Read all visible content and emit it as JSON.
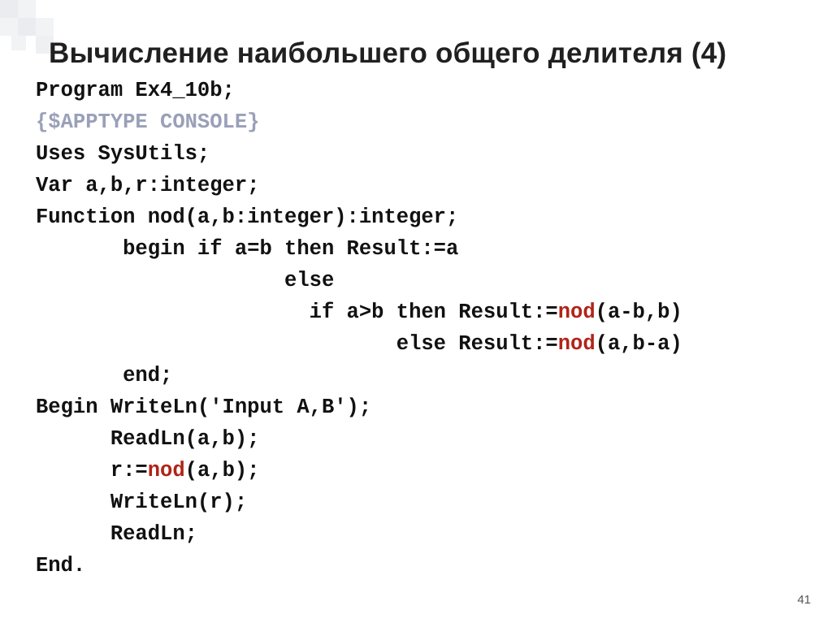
{
  "title": "Вычисление наибольшего общего делителя (4)",
  "page_number": "41",
  "code": {
    "l1": "Program Ex4_10b;",
    "l2": "{$APPTYPE CONSOLE}",
    "l3": "Uses SysUtils;",
    "l4": "Var a,b,r:integer;",
    "l5": "Function nod(a,b:integer):integer;",
    "l6": "       begin if a=b then Result:=a",
    "l7": "                    else",
    "l8_a": "                      if a>b then Result:=",
    "l8_call": "nod",
    "l8_b": "(a-b,b)",
    "l9_a": "                             else Result:=",
    "l9_call": "nod",
    "l9_b": "(a,b-a)",
    "l10": "       end;",
    "l11": "Begin WriteLn('Input A,B');",
    "l12": "      ReadLn(a,b);",
    "l13_a": "      r:=",
    "l13_call": "nod",
    "l13_b": "(a,b);",
    "l14": "      WriteLn(r);",
    "l15": "      ReadLn;",
    "l16": "End."
  }
}
